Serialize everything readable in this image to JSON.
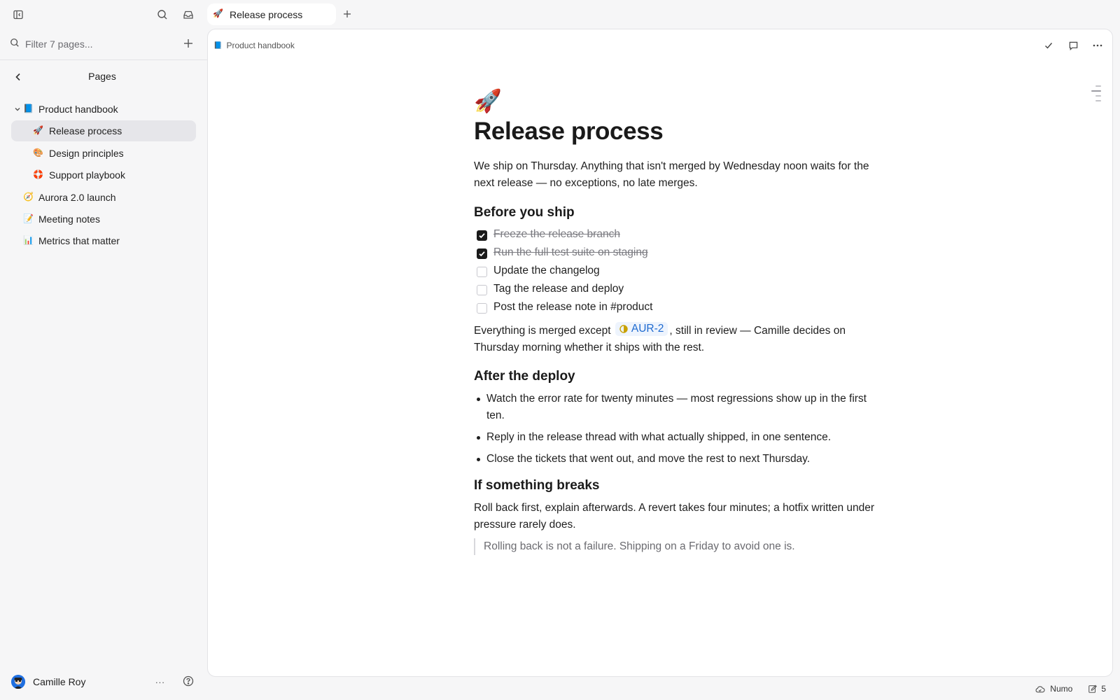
{
  "sidebar": {
    "filter_placeholder": "Filter 7 pages...",
    "pages_title": "Pages",
    "tree": [
      {
        "emoji": "📘",
        "label": "Product handbook",
        "level": 0,
        "expanded": true
      },
      {
        "emoji": "🚀",
        "label": "Release process",
        "level": 1,
        "active": true
      },
      {
        "emoji": "🎨",
        "label": "Design principles",
        "level": 1
      },
      {
        "emoji": "🛟",
        "label": "Support playbook",
        "level": 1
      },
      {
        "emoji": "🧭",
        "label": "Aurora 2.0 launch",
        "level": 0
      },
      {
        "emoji": "📝",
        "label": "Meeting notes",
        "level": 0
      },
      {
        "emoji": "📊",
        "label": "Metrics that matter",
        "level": 0
      }
    ],
    "user": {
      "name": "Camille Roy",
      "more": "..."
    }
  },
  "tab": {
    "emoji": "🚀",
    "label": "Release process"
  },
  "breadcrumb": {
    "emoji": "📘",
    "label": "Product handbook"
  },
  "doc": {
    "emoji": "🚀",
    "title": "Release process",
    "intro": "We ship on Thursday. Anything that isn't merged by Wednesday noon waits for the next release — no exceptions, no late merges.",
    "section1": "Before you ship",
    "checklist": [
      {
        "text": "Freeze the release branch",
        "checked": true
      },
      {
        "text": "Run the full test suite on staging",
        "checked": true
      },
      {
        "text": "Update the changelog",
        "checked": false
      },
      {
        "text": "Tag the release and deploy",
        "checked": false
      },
      {
        "text": "Post the release note in #product",
        "checked": false
      }
    ],
    "merged_before": "Everything is merged except",
    "issue_chip": "AUR-2",
    "merged_after": ", still in review — Camille decides on Thursday morning whether it ships with the rest.",
    "section2": "After the deploy",
    "bullets": [
      "Watch the error rate for twenty minutes — most regressions show up in the first ten.",
      "Reply in the release thread with what actually shipped, in one sentence.",
      "Close the tickets that went out, and move the rest to next Thursday."
    ],
    "section3": "If something breaks",
    "rollback": "Roll back first, explain afterwards. A revert takes four minutes; a hotfix written under pressure rarely does.",
    "quote": "Rolling back is not a failure. Shipping on a Friday to avoid one is."
  },
  "status": {
    "workspace": "Numo",
    "count": "5"
  },
  "colors": {
    "accent": "#1f6bd0",
    "active_bg": "#e6e6ea",
    "sidebar_bg": "#f6f6f7"
  }
}
